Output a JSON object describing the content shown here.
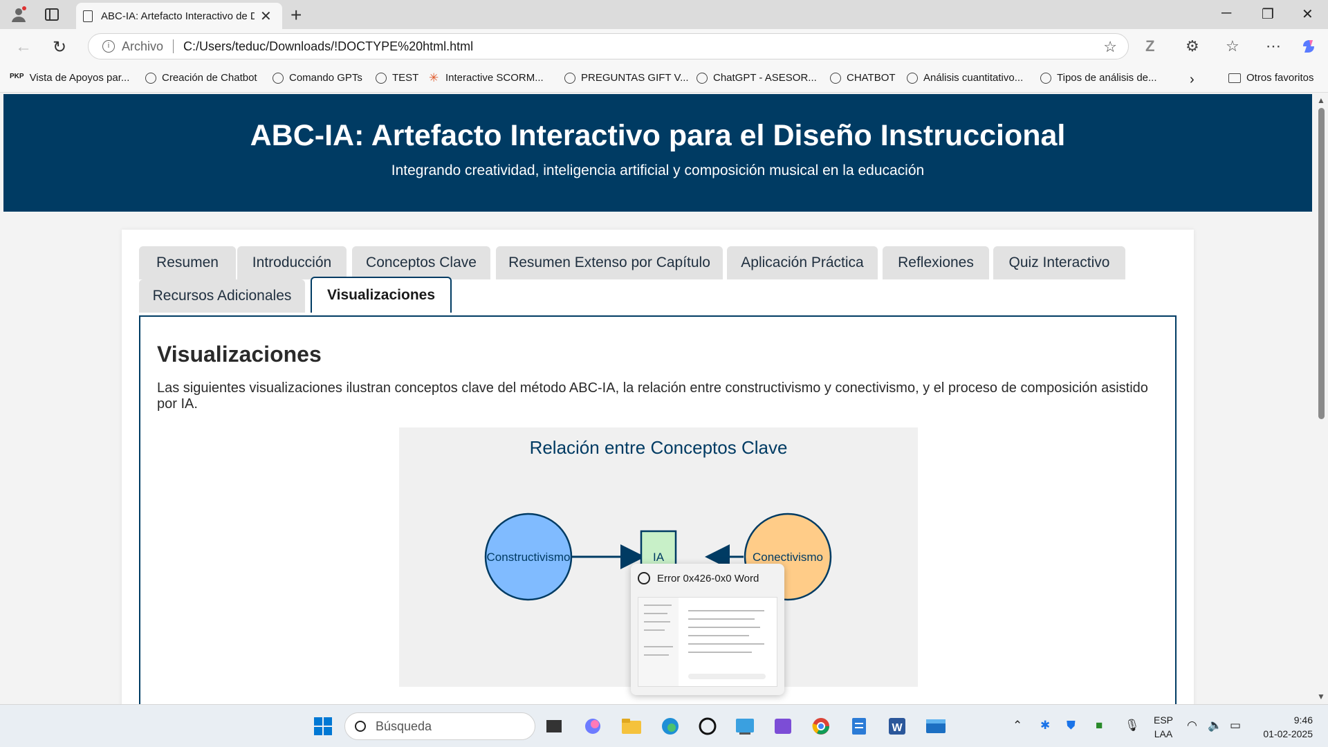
{
  "browser": {
    "tab_title": "ABC-IA: Artefacto Interactivo de Diseño",
    "address_scheme_label": "Archivo",
    "address_url": "C:/Users/teduc/Downloads/!DOCTYPE%20html.html",
    "bookmarks": [
      "Vista de Apoyos par...",
      "Creación de Chatbot",
      "Comando GPTs",
      "TEST",
      "Interactive SCORM...",
      "PREGUNTAS GIFT V...",
      "ChatGPT - ASESOR...",
      "CHATBOT",
      "Análisis cuantitativo...",
      "Tipos de análisis de..."
    ],
    "other_favorites": "Otros favoritos"
  },
  "page": {
    "title": "ABC-IA: Artefacto Interactivo para el Diseño Instruccional",
    "subtitle": "Integrando creatividad, inteligencia artificial y composición musical en la educación",
    "tabs": [
      "Resumen",
      "Introducción",
      "Conceptos Clave",
      "Resumen Extenso por Capítulo",
      "Aplicación Práctica",
      "Reflexiones",
      "Quiz Interactivo",
      "Recursos Adicionales",
      "Visualizaciones"
    ],
    "active_tab": "Visualizaciones",
    "section_title": "Visualizaciones",
    "section_desc": "Las siguientes visualizaciones ilustran conceptos clave del método ABC-IA, la relación entre constructivismo y conectivismo, y el proceso de composición asistido por IA.",
    "diagram": {
      "title": "Relación entre Conceptos Clave",
      "nodes": {
        "left": "Constructivismo",
        "center": "IA",
        "right": "Conectivismo"
      },
      "colors": {
        "left_fill": "#80bbff",
        "center_fill": "#c8f0c8",
        "right_fill": "#ffcc88",
        "stroke": "#003b63"
      }
    }
  },
  "popup": {
    "title": "Error 0x426-0x0 Word"
  },
  "taskbar": {
    "search_placeholder": "Búsqueda",
    "lang_top": "ESP",
    "lang_bottom": "LAA",
    "time": "9:46",
    "date": "01-02-2025"
  },
  "colors": {
    "brand": "#003b63"
  }
}
